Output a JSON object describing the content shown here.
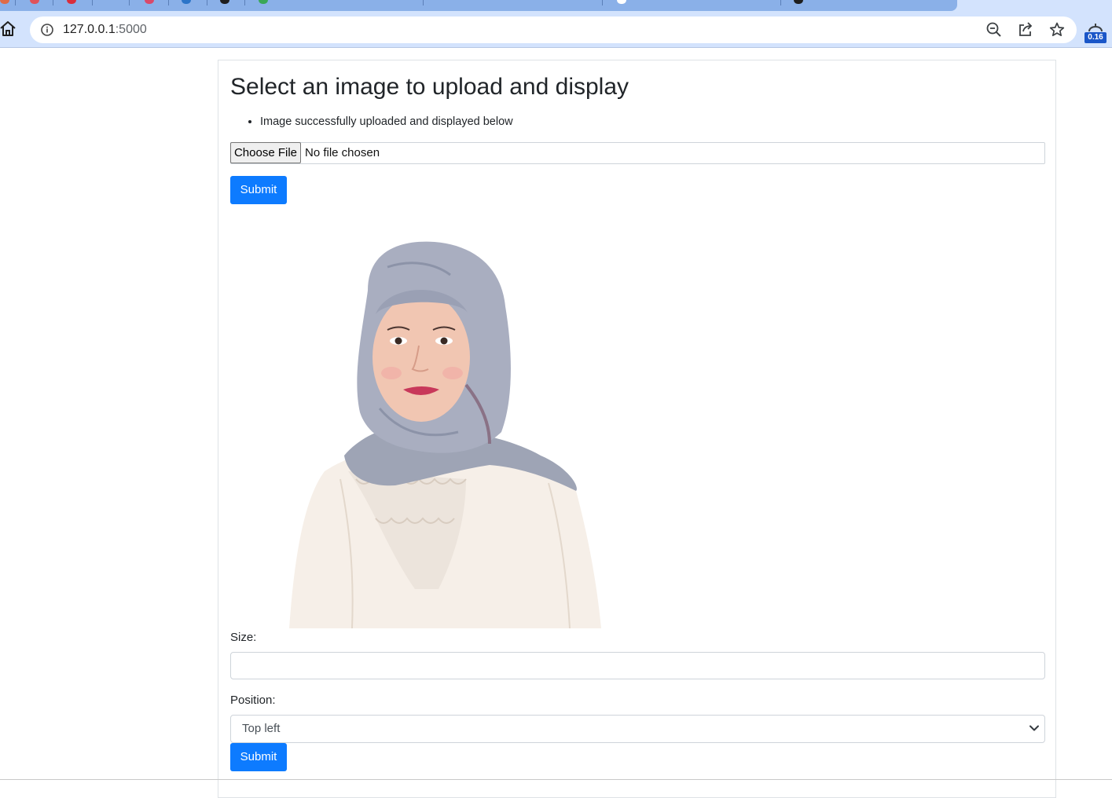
{
  "browser": {
    "url_host": "127.0.0.1",
    "url_port": ":5000",
    "extension_badge": "0.16"
  },
  "page": {
    "title": "Select an image to upload and display",
    "flash_messages": [
      "Image successfully uploaded and displayed below"
    ],
    "file_input": {
      "button_label": "Choose File",
      "status": "No file chosen"
    },
    "upload_submit_label": "Submit",
    "size_label": "Size:",
    "size_value": "",
    "position_label": "Position:",
    "position_selected": "Top left",
    "form_submit_label": "Submit"
  },
  "colors": {
    "primary_button": "#0d7bff",
    "chrome_toolbar": "#d3e3fd"
  },
  "icons": [
    "home-icon",
    "info-icon",
    "zoom-out-icon",
    "share-icon",
    "bookmark-star-icon",
    "extension-icon",
    "chevron-down-icon"
  ]
}
